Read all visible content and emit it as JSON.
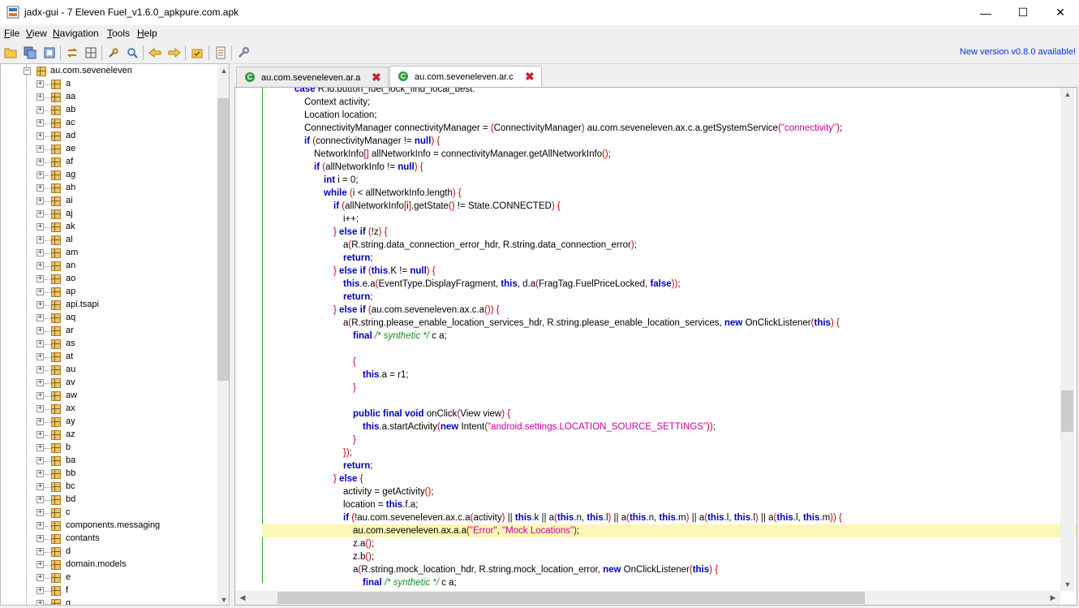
{
  "window": {
    "title": "jadx-gui - 7 Eleven Fuel_v1.6.0_apkpure.com.apk",
    "minimize": "—",
    "maximize": "☐",
    "close": "✕"
  },
  "menu": [
    {
      "mn": "F",
      "rest": "ile"
    },
    {
      "mn": "V",
      "rest": "iew"
    },
    {
      "mn": "N",
      "rest": "avigation"
    },
    {
      "mn": "T",
      "rest": "ools"
    },
    {
      "mn": "H",
      "rest": "elp"
    }
  ],
  "toolbar": {
    "new_version": "New version v0.8.0 available!",
    "icons": [
      "open-file-icon",
      "save-all-icon",
      "export-icon",
      "sync-icon",
      "flat-packages-icon",
      "search-icon",
      "find-icon",
      "back-icon",
      "forward-icon",
      "decompile-icon",
      "log-icon",
      "preferences-icon"
    ]
  },
  "tree": {
    "root": "au.com.seveneleven",
    "items": [
      "a",
      "aa",
      "ab",
      "ac",
      "ad",
      "ae",
      "af",
      "ag",
      "ah",
      "ai",
      "aj",
      "ak",
      "al",
      "am",
      "an",
      "ao",
      "ap",
      "api.tsapi",
      "aq",
      "ar",
      "as",
      "at",
      "au",
      "av",
      "aw",
      "ax",
      "ay",
      "az",
      "b",
      "ba",
      "bb",
      "bc",
      "bd",
      "c",
      "components.messaging",
      "contants",
      "d",
      "domain.models",
      "e",
      "f",
      "g"
    ]
  },
  "tabs": [
    {
      "label": "au.com.seveneleven.ar.a",
      "active": false
    },
    {
      "label": "au.com.seveneleven.ar.c",
      "active": true
    }
  ],
  "code": {
    "highlight_line_index": 34,
    "lines": [
      {
        "indent": 3,
        "parts": [
          [
            "kw",
            "case"
          ],
          [
            "t",
            " R.id.button_fuel_lock_find_local_best:"
          ]
        ]
      },
      {
        "indent": 4,
        "parts": [
          [
            "t",
            "Context activity;"
          ]
        ]
      },
      {
        "indent": 4,
        "parts": [
          [
            "t",
            "Location location;"
          ]
        ]
      },
      {
        "indent": 4,
        "parts": [
          [
            "t",
            "ConnectivityManager connectivityManager = "
          ],
          [
            "br",
            "("
          ],
          [
            "t",
            "ConnectivityManager"
          ],
          [
            "br",
            ")"
          ],
          [
            "t",
            " au.com.seveneleven.ax.c.a.getSystemService"
          ],
          [
            "br",
            "("
          ],
          [
            "str",
            "\"connectivity\""
          ],
          [
            "br",
            ")"
          ],
          [
            "t",
            ";"
          ]
        ]
      },
      {
        "indent": 4,
        "parts": [
          [
            "kw",
            "if"
          ],
          [
            "t",
            " "
          ],
          [
            "br",
            "("
          ],
          [
            "t",
            "connectivityManager != "
          ],
          [
            "kw",
            "null"
          ],
          [
            "br",
            ")"
          ],
          [
            "t",
            " "
          ],
          [
            "br",
            "{"
          ]
        ]
      },
      {
        "indent": 5,
        "parts": [
          [
            "t",
            "NetworkInfo"
          ],
          [
            "br",
            "[]"
          ],
          [
            "t",
            " allNetworkInfo = connectivityManager.getAllNetworkInfo"
          ],
          [
            "br",
            "()"
          ],
          [
            "t",
            ";"
          ]
        ]
      },
      {
        "indent": 5,
        "parts": [
          [
            "kw",
            "if"
          ],
          [
            "t",
            " "
          ],
          [
            "br",
            "("
          ],
          [
            "t",
            "allNetworkInfo != "
          ],
          [
            "kw",
            "null"
          ],
          [
            "br",
            ")"
          ],
          [
            "t",
            " "
          ],
          [
            "br",
            "{"
          ]
        ]
      },
      {
        "indent": 6,
        "parts": [
          [
            "kw",
            "int"
          ],
          [
            "t",
            " i = 0;"
          ]
        ]
      },
      {
        "indent": 6,
        "parts": [
          [
            "kw",
            "while"
          ],
          [
            "t",
            " "
          ],
          [
            "br",
            "("
          ],
          [
            "t",
            "i < allNetworkInfo.length"
          ],
          [
            "br",
            ")"
          ],
          [
            "t",
            " "
          ],
          [
            "br",
            "{"
          ]
        ]
      },
      {
        "indent": 7,
        "parts": [
          [
            "kw",
            "if"
          ],
          [
            "t",
            " "
          ],
          [
            "br",
            "("
          ],
          [
            "t",
            "allNetworkInfo"
          ],
          [
            "br",
            "["
          ],
          [
            "t",
            "i"
          ],
          [
            "br",
            "]"
          ],
          [
            "t",
            ".getState"
          ],
          [
            "br",
            "()"
          ],
          [
            "t",
            " != State.CONNECTED"
          ],
          [
            "br",
            ")"
          ],
          [
            "t",
            " "
          ],
          [
            "br",
            "{"
          ]
        ]
      },
      {
        "indent": 8,
        "parts": [
          [
            "t",
            "i++;"
          ]
        ]
      },
      {
        "indent": 7,
        "parts": [
          [
            "br",
            "}"
          ],
          [
            "t",
            " "
          ],
          [
            "kw",
            "else if"
          ],
          [
            "t",
            " "
          ],
          [
            "br",
            "("
          ],
          [
            "t",
            "!z"
          ],
          [
            "br",
            ")"
          ],
          [
            "t",
            " "
          ],
          [
            "br",
            "{"
          ]
        ]
      },
      {
        "indent": 8,
        "parts": [
          [
            "t",
            "a"
          ],
          [
            "br",
            "("
          ],
          [
            "t",
            "R.string.data_connection_error_hdr, R.string.data_connection_error"
          ],
          [
            "br",
            ")"
          ],
          [
            "t",
            ";"
          ]
        ]
      },
      {
        "indent": 8,
        "parts": [
          [
            "kw",
            "return"
          ],
          [
            "t",
            ";"
          ]
        ]
      },
      {
        "indent": 7,
        "parts": [
          [
            "br",
            "}"
          ],
          [
            "t",
            " "
          ],
          [
            "kw",
            "else if"
          ],
          [
            "t",
            " "
          ],
          [
            "br",
            "("
          ],
          [
            "kw",
            "this"
          ],
          [
            "t",
            ".K != "
          ],
          [
            "kw",
            "null"
          ],
          [
            "br",
            ")"
          ],
          [
            "t",
            " "
          ],
          [
            "br",
            "{"
          ]
        ]
      },
      {
        "indent": 8,
        "parts": [
          [
            "kw",
            "this"
          ],
          [
            "t",
            ".e.a"
          ],
          [
            "br",
            "("
          ],
          [
            "t",
            "EventType.DisplayFragment, "
          ],
          [
            "kw",
            "this"
          ],
          [
            "t",
            ", d.a"
          ],
          [
            "br",
            "("
          ],
          [
            "t",
            "FragTag.FuelPriceLocked, "
          ],
          [
            "kw",
            "false"
          ],
          [
            "br",
            "))"
          ],
          [
            "t",
            ";"
          ]
        ]
      },
      {
        "indent": 8,
        "parts": [
          [
            "kw",
            "return"
          ],
          [
            "t",
            ";"
          ]
        ]
      },
      {
        "indent": 7,
        "parts": [
          [
            "br",
            "}"
          ],
          [
            "t",
            " "
          ],
          [
            "kw",
            "else if"
          ],
          [
            "t",
            " "
          ],
          [
            "br",
            "("
          ],
          [
            "t",
            "au.com.seveneleven.ax.c.a"
          ],
          [
            "br",
            "())"
          ],
          [
            "t",
            " "
          ],
          [
            "br",
            "{"
          ]
        ]
      },
      {
        "indent": 8,
        "parts": [
          [
            "t",
            "a"
          ],
          [
            "br",
            "("
          ],
          [
            "t",
            "R.string.please_enable_location_services_hdr, R.string.please_enable_location_services, "
          ],
          [
            "kw",
            "new"
          ],
          [
            "t",
            " OnClickListener"
          ],
          [
            "br",
            "("
          ],
          [
            "kw",
            "this"
          ],
          [
            "br",
            ")"
          ],
          [
            "t",
            " "
          ],
          [
            "br",
            "{"
          ]
        ]
      },
      {
        "indent": 9,
        "parts": [
          [
            "kw",
            "final"
          ],
          [
            "t",
            " "
          ],
          [
            "com",
            "/* synthetic */"
          ],
          [
            "t",
            " c a;"
          ]
        ]
      },
      {
        "indent": 9,
        "parts": []
      },
      {
        "indent": 9,
        "parts": [
          [
            "br",
            "{"
          ]
        ]
      },
      {
        "indent": 10,
        "parts": [
          [
            "kw",
            "this"
          ],
          [
            "t",
            ".a = r1;"
          ]
        ]
      },
      {
        "indent": 9,
        "parts": [
          [
            "br",
            "}"
          ]
        ]
      },
      {
        "indent": 9,
        "parts": []
      },
      {
        "indent": 9,
        "parts": [
          [
            "kw",
            "public final void"
          ],
          [
            "t",
            " onClick"
          ],
          [
            "br",
            "("
          ],
          [
            "t",
            "View view"
          ],
          [
            "br",
            ")"
          ],
          [
            "t",
            " "
          ],
          [
            "br",
            "{"
          ]
        ]
      },
      {
        "indent": 10,
        "parts": [
          [
            "kw",
            "this"
          ],
          [
            "t",
            ".a.startActivity"
          ],
          [
            "br",
            "("
          ],
          [
            "kw",
            "new"
          ],
          [
            "t",
            " Intent"
          ],
          [
            "br",
            "("
          ],
          [
            "str",
            "\"android.settings.LOCATION_SOURCE_SETTINGS\""
          ],
          [
            "br",
            "))"
          ],
          [
            "t",
            ";"
          ]
        ]
      },
      {
        "indent": 9,
        "parts": [
          [
            "br",
            "}"
          ]
        ]
      },
      {
        "indent": 8,
        "parts": [
          [
            "br",
            "})"
          ],
          [
            "t",
            ";"
          ]
        ]
      },
      {
        "indent": 8,
        "parts": [
          [
            "kw",
            "return"
          ],
          [
            "t",
            ";"
          ]
        ]
      },
      {
        "indent": 7,
        "parts": [
          [
            "br",
            "}"
          ],
          [
            "t",
            " "
          ],
          [
            "kw",
            "else"
          ],
          [
            "t",
            " "
          ],
          [
            "br",
            "{"
          ]
        ]
      },
      {
        "indent": 8,
        "parts": [
          [
            "t",
            "activity = getActivity"
          ],
          [
            "br",
            "()"
          ],
          [
            "t",
            ";"
          ]
        ]
      },
      {
        "indent": 8,
        "parts": [
          [
            "t",
            "location = "
          ],
          [
            "kw",
            "this"
          ],
          [
            "t",
            ".f.a;"
          ]
        ]
      },
      {
        "indent": 8,
        "parts": [
          [
            "kw",
            "if"
          ],
          [
            "t",
            " "
          ],
          [
            "br",
            "("
          ],
          [
            "t",
            "!au.com.seveneleven.ax.c.a"
          ],
          [
            "br",
            "("
          ],
          [
            "t",
            "activity"
          ],
          [
            "br",
            ")"
          ],
          [
            "t",
            " || "
          ],
          [
            "kw",
            "this"
          ],
          [
            "t",
            ".k || a"
          ],
          [
            "br",
            "("
          ],
          [
            "kw",
            "this"
          ],
          [
            "t",
            ".n, "
          ],
          [
            "kw",
            "this"
          ],
          [
            "t",
            ".l"
          ],
          [
            "br",
            ")"
          ],
          [
            "t",
            " || a"
          ],
          [
            "br",
            "("
          ],
          [
            "kw",
            "this"
          ],
          [
            "t",
            ".n, "
          ],
          [
            "kw",
            "this"
          ],
          [
            "t",
            ".m"
          ],
          [
            "br",
            ")"
          ],
          [
            "t",
            " || a"
          ],
          [
            "br",
            "("
          ],
          [
            "kw",
            "this"
          ],
          [
            "t",
            ".l, "
          ],
          [
            "kw",
            "this"
          ],
          [
            "t",
            ".l"
          ],
          [
            "br",
            ")"
          ],
          [
            "t",
            " || a"
          ],
          [
            "br",
            "("
          ],
          [
            "kw",
            "this"
          ],
          [
            "t",
            ".l, "
          ],
          [
            "kw",
            "this"
          ],
          [
            "t",
            ".m"
          ],
          [
            "br",
            "))"
          ],
          [
            "t",
            " "
          ],
          [
            "br",
            "{"
          ]
        ]
      },
      {
        "indent": 9,
        "parts": [
          [
            "t",
            "au.com.seveneleven.ax.a.a"
          ],
          [
            "br",
            "("
          ],
          [
            "str",
            "\"Error\""
          ],
          [
            "t",
            ", "
          ],
          [
            "str",
            "\"Mock Locations\""
          ],
          [
            "br",
            ")"
          ],
          [
            "t",
            ";"
          ]
        ]
      },
      {
        "indent": 9,
        "parts": [
          [
            "t",
            "z.a"
          ],
          [
            "br",
            "()"
          ],
          [
            "t",
            ";"
          ]
        ]
      },
      {
        "indent": 9,
        "parts": [
          [
            "t",
            "z.b"
          ],
          [
            "br",
            "()"
          ],
          [
            "t",
            ";"
          ]
        ]
      },
      {
        "indent": 9,
        "parts": [
          [
            "t",
            "a"
          ],
          [
            "br",
            "("
          ],
          [
            "t",
            "R.string.mock_location_hdr, R.string.mock_location_error, "
          ],
          [
            "kw",
            "new"
          ],
          [
            "t",
            " OnClickListener"
          ],
          [
            "br",
            "("
          ],
          [
            "kw",
            "this"
          ],
          [
            "br",
            ")"
          ],
          [
            "t",
            " "
          ],
          [
            "br",
            "{"
          ]
        ]
      },
      {
        "indent": 10,
        "parts": [
          [
            "kw",
            "final"
          ],
          [
            "t",
            " "
          ],
          [
            "com",
            "/* synthetic */"
          ],
          [
            "t",
            " c a;"
          ]
        ]
      }
    ]
  }
}
